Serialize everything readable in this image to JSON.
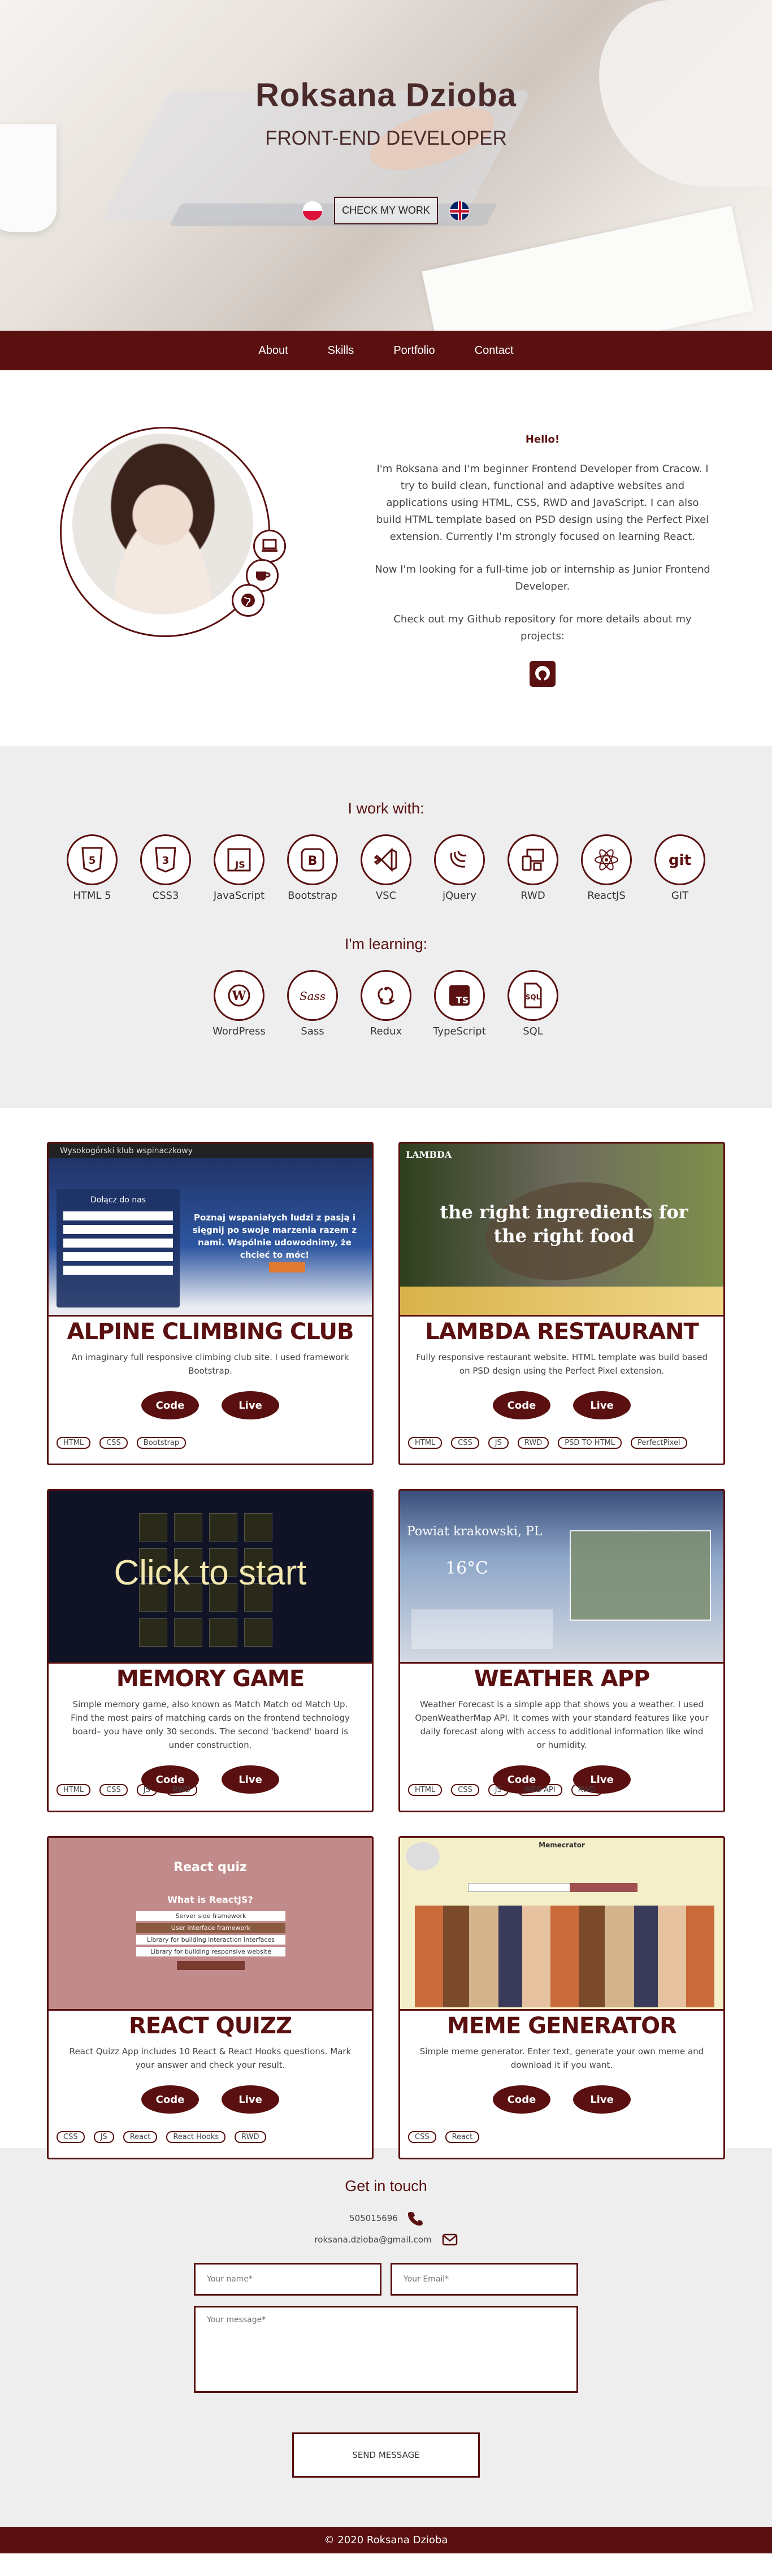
{
  "hero": {
    "name": "Roksana Dzioba",
    "role": "FRONT-END DEVELOPER",
    "check_work": "CHECK MY WORK"
  },
  "nav": [
    "About",
    "Skills",
    "Portfolio",
    "Contact"
  ],
  "about": {
    "hello": "Hello!",
    "p1": "I'm Roksana and I'm beginner Frontend Developer from Cracow. I try to build clean, functional and adaptive websites and applications using HTML, CSS, RWD and JavaScript. I can also build HTML template based on PSD design using the Perfect Pixel extension. Currently I'm strongly focused on learning React.",
    "p2": "Now I'm looking for a full-time job or internship as Junior Frontend Developer.",
    "p3": "Check out my Github repository for more details about my projects:"
  },
  "skills": {
    "work_title": "I work with:",
    "work": [
      "HTML 5",
      "CSS3",
      "JavaScript",
      "Bootstrap",
      "VSC",
      "jQuery",
      "RWD",
      "ReactJS",
      "GIT"
    ],
    "learn_title": "I'm learning:",
    "learn": [
      "WordPress",
      "Sass",
      "Redux",
      "TypeScript",
      "SQL"
    ]
  },
  "projects": [
    {
      "title": "ALPINE CLIMBING CLUB",
      "desc": "An imaginary full responsive climbing club site. I used framework Bootstrap.",
      "code": "Code",
      "live": "Live",
      "tags": [
        "HTML",
        "CSS",
        "Bootstrap"
      ]
    },
    {
      "title": "LAMBDA RESTAURANT",
      "desc": "Fully responsive restaurant website. HTML template was build based on PSD design using the Perfect Pixel extension.",
      "code": "Code",
      "live": "Live",
      "tags": [
        "HTML",
        "CSS",
        "JS",
        "RWD",
        "PSD TO HTML",
        "PerfectPixel"
      ]
    },
    {
      "title": "MEMORY GAME",
      "desc": "Simple memory game, also known as Match Match od Match Up. Find the most pairs of matching cards on the frontend technology board– you have only 30 seconds. The second 'backend' board is under construction.",
      "code": "Code",
      "live": "Live",
      "tags": [
        "HTML",
        "CSS",
        "JS",
        "RWD"
      ]
    },
    {
      "title": "WEATHER APP",
      "desc": "Weather Forecast is a simple app that shows you a weather. I used OpenWeatherMap API. It comes with your standard features like your daily forecast along with access to additional information like wind or humidity.",
      "code": "Code",
      "live": "Live",
      "tags": [
        "HTML",
        "CSS",
        "JS",
        "WEB API",
        "RWD"
      ]
    },
    {
      "title": "REACT QUIZZ",
      "desc": "React Quizz App includes 10 React & React Hooks questions. Mark your answer and check your result.",
      "code": "Code",
      "live": "Live",
      "tags": [
        "CSS",
        "JS",
        "React",
        "React Hooks",
        "RWD"
      ]
    },
    {
      "title": "MEME GENERATOR",
      "desc": "Simple meme generator. Enter text, generate your own meme and download it if you want.",
      "code": "Code",
      "live": "Live",
      "tags": [
        "CSS",
        "React"
      ]
    }
  ],
  "shots": {
    "climb_header": "Wysokogórski klub wspinaczkowy",
    "climb_join": "Dołącz do nas",
    "climb_text": "Poznaj wspaniałych ludzi z pasją i sięgnij po swoje marzenia razem z nami. Wspólnie udowodnimy, że chcieć to móc!",
    "lambda_brand": "LAMBDA",
    "lambda_text": "the right ingredients for the right food",
    "memory_text": "Click to start",
    "weather_city": "Powiat krakowski, PL",
    "weather_temp": "16°C",
    "quiz_title": "React quiz",
    "quiz_q": "What is ReactJS?",
    "quiz_a": [
      "Server side framework",
      "User interface framework",
      "Library for building interaction interfaces",
      "Library for building responsive website"
    ],
    "meme_title": "Memecrator"
  },
  "contact": {
    "title": "Get in touch",
    "phone": "505015696",
    "email": "roksana.dzioba@gmail.com",
    "name_ph": "Your name*",
    "email_ph": "Your Email*",
    "msg_ph": "Your message*",
    "send": "SEND MESSAGE"
  },
  "footer": "© 2020 Roksana Dzioba",
  "colors": {
    "accent": "#5a1010",
    "bg_gray": "#eeeeee"
  }
}
